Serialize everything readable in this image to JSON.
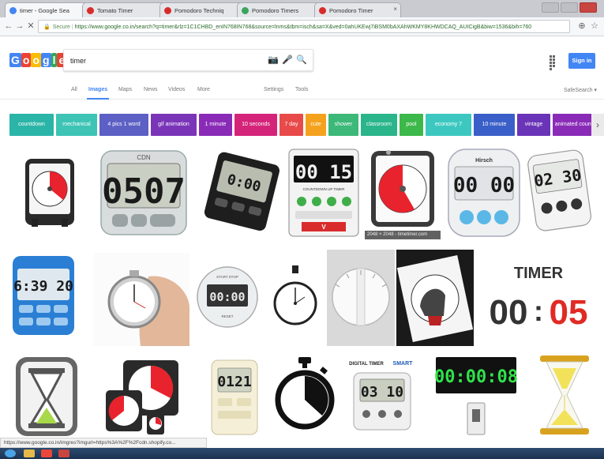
{
  "browser": {
    "tabs": [
      {
        "title": "timer - Google Sea",
        "fav": "#4285f4",
        "active": true
      },
      {
        "title": "Tomato Timer",
        "fav": "#d92b2b",
        "active": false
      },
      {
        "title": "Pomodoro Techniq",
        "fav": "#d92b2b",
        "active": false
      },
      {
        "title": "Pomodoro Timers",
        "fav": "#3ba55c",
        "active": false
      },
      {
        "title": "Pomodoro Timer",
        "fav": "#d92b2b",
        "active": false
      }
    ],
    "secure_label": "Secure",
    "url": "https://www.google.co.in/search?q=timer&rlz=1C1CHBD_enIN768IN768&source=lnms&tbm=isch&sa=X&ved=0ahUKEwj7iBSM0bAXAhWKMY8KHWDCAQ_AUICigB&biw=1536&bih=760",
    "tab_close": "×"
  },
  "google": {
    "logo": "Google",
    "logo_colors": [
      "#4285f4",
      "#ea4335",
      "#fbbc05",
      "#4285f4",
      "#34a853",
      "#ea4335"
    ],
    "query": "timer",
    "camera_icon": "📷",
    "mic_icon": "🎤",
    "search_icon": "🔍",
    "sign_in": "Sign in",
    "safesearch": "SafeSearch ▾"
  },
  "nav_tabs": [
    {
      "label": "All",
      "active": false
    },
    {
      "label": "Images",
      "active": true
    },
    {
      "label": "Maps",
      "active": false
    },
    {
      "label": "News",
      "active": false
    },
    {
      "label": "Videos",
      "active": false
    },
    {
      "label": "More",
      "active": false
    },
    {
      "label": "Settings",
      "active": false
    },
    {
      "label": "Tools",
      "active": false
    }
  ],
  "chips": [
    {
      "label": "countdown",
      "color": "#2bb5a8"
    },
    {
      "label": "mechanical",
      "color": "#3dc4b4"
    },
    {
      "label": "4 pics 1 word",
      "color": "#5c5fc4"
    },
    {
      "label": "gif animation",
      "color": "#7a34b8"
    },
    {
      "label": "1 minute",
      "color": "#8a2bb8"
    },
    {
      "label": "10 seconds",
      "color": "#d4247a"
    },
    {
      "label": "7 day",
      "color": "#e84a4a"
    },
    {
      "label": "cute",
      "color": "#f4a21e"
    },
    {
      "label": "shower",
      "color": "#3cb878"
    },
    {
      "label": "classroom",
      "color": "#2bb58a"
    },
    {
      "label": "pool",
      "color": "#3db84a"
    },
    {
      "label": "economy 7",
      "color": "#3cc8c0"
    },
    {
      "label": "10 minute",
      "color": "#3a5fc8"
    },
    {
      "label": "vintage",
      "color": "#6a34b8"
    },
    {
      "label": "animated countdown",
      "color": "#8a2bb8"
    }
  ],
  "images": {
    "img2_display": "0507",
    "img2_brand": "CDN",
    "img3_display": "0:00",
    "img4_display": "00 15",
    "img4_label": "COUNTDOWN UP TIMER",
    "img5_caption": "2048 × 2048 - timetimer.com",
    "img6_brand": "Hirsch",
    "img6_display": "00 00",
    "img7_display": "02 30",
    "img8_display": "6:39 20",
    "img10_display": "00:00",
    "img10_top": "START STOP",
    "img10_bottom": "RESET",
    "img13_title": "TIMER",
    "img13_left": "00",
    "img13_colon": ":",
    "img13_right": "05",
    "img17_title": "DIGITAL TIMER",
    "img17_display": "03 10",
    "img18_display": "00:00:08"
  },
  "status_url": "https://www.google.co.in/imgres?imgurl=https%3A%2F%2Fcdn.shopify.co..."
}
